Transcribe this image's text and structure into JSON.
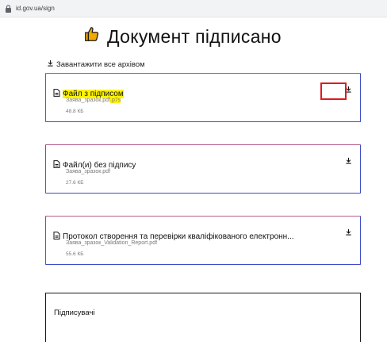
{
  "browser": {
    "url": "id.gov.ua/sign"
  },
  "page": {
    "title": "Документ підписано",
    "download_all_label": "Завантажити все архівом"
  },
  "files": [
    {
      "name_highlighted": "Файл з підписом",
      "name_rest": "",
      "filename": "Заява_зразок.pdf",
      "filename_ext": ".p7s",
      "size": "48.8 КБ"
    },
    {
      "name": "Файл(и) без підпису",
      "filename": "Заява_зразок.pdf",
      "size": "27.6 КБ"
    },
    {
      "name": "Протокол створення та перевірки кваліфікованого електронн...",
      "filename": "Заява_зразок_Validation_Report.pdf",
      "size": "55.6 КБ"
    }
  ],
  "signers": {
    "label": "Підписувачі"
  },
  "colors": {
    "highlight": "#fff200",
    "annotation": "#e0191e",
    "card_border": "#3d4cc9",
    "thumb_icon": "#f2a900"
  },
  "icons": {
    "title": "thumbs-up-icon",
    "file": "document-icon",
    "download": "download-icon",
    "address": "lock-icon"
  }
}
